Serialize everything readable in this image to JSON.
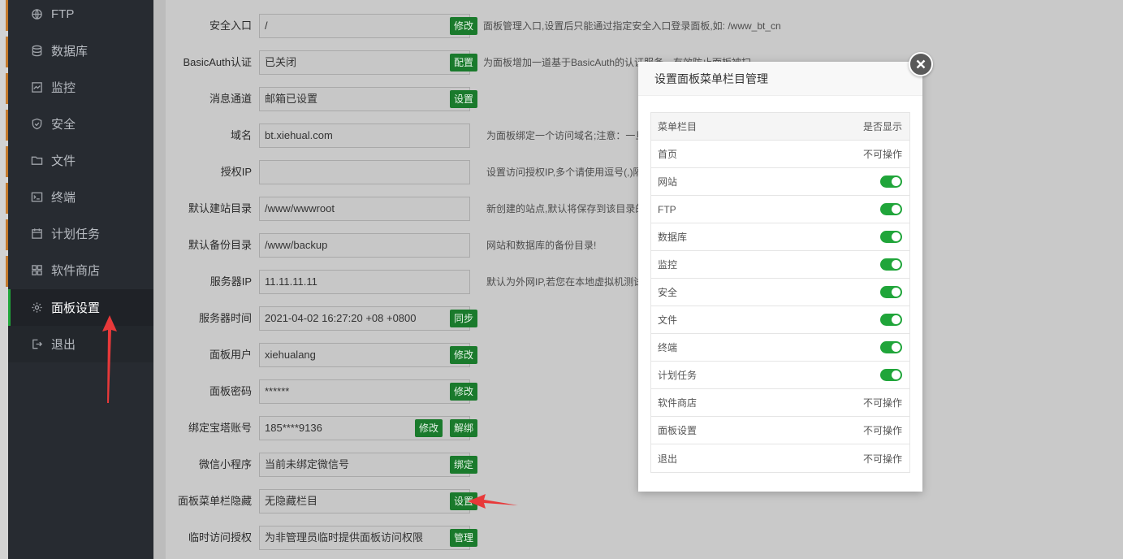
{
  "sidebar": {
    "items": [
      {
        "label": "FTP",
        "icon": "ftp-icon"
      },
      {
        "label": "数据库",
        "icon": "database-icon"
      },
      {
        "label": "监控",
        "icon": "monitor-icon"
      },
      {
        "label": "安全",
        "icon": "shield-icon"
      },
      {
        "label": "文件",
        "icon": "folder-icon"
      },
      {
        "label": "终端",
        "icon": "terminal-icon"
      },
      {
        "label": "计划任务",
        "icon": "calendar-icon"
      },
      {
        "label": "软件商店",
        "icon": "apps-icon"
      },
      {
        "label": "面板设置",
        "icon": "gear-icon"
      },
      {
        "label": "退出",
        "icon": "logout-icon"
      }
    ],
    "active": "面板设置"
  },
  "settings": {
    "rows": [
      {
        "label": "安全入口",
        "value": "/",
        "buttons": [
          "修改"
        ],
        "hint": "面板管理入口,设置后只能通过指定安全入口登录面板,如: /www_bt_cn"
      },
      {
        "label": "BasicAuth认证",
        "value": "已关闭",
        "buttons": [
          "配置"
        ],
        "hint": "为面板增加一道基于BasicAuth的认证服务，有效防止面板被扫"
      },
      {
        "label": "消息通道",
        "value": "邮箱已设置",
        "buttons": [
          "设置"
        ],
        "hint": ""
      },
      {
        "label": "域名",
        "value": "bt.xiehual.com",
        "buttons": [],
        "hint": "为面板绑定一个访问域名;注意：一旦"
      },
      {
        "label": "授权IP",
        "value": "",
        "buttons": [],
        "hint": "设置访问授权IP,多个请使用逗号(,)隔"
      },
      {
        "label": "默认建站目录",
        "value": "/www/wwwroot",
        "buttons": [],
        "hint": "新创建的站点,默认将保存到该目录的"
      },
      {
        "label": "默认备份目录",
        "value": "/www/backup",
        "buttons": [],
        "hint": "网站和数据库的备份目录!"
      },
      {
        "label": "服务器IP",
        "value": "11.11.11.11",
        "buttons": [],
        "hint": "默认为外网IP,若您在本地虚拟机测试"
      },
      {
        "label": "服务器时间",
        "value": "2021-04-02 16:27:20 +08 +0800",
        "buttons": [
          "同步"
        ],
        "hint": ""
      },
      {
        "label": "面板用户",
        "value": "xiehualang",
        "buttons": [
          "修改"
        ],
        "hint": ""
      },
      {
        "label": "面板密码",
        "value": "******",
        "buttons": [
          "修改"
        ],
        "hint": ""
      },
      {
        "label": "绑定宝塔账号",
        "value": "185****9136",
        "buttons": [
          "修改",
          "解绑"
        ],
        "hint": ""
      },
      {
        "label": "微信小程序",
        "value": "当前未绑定微信号",
        "buttons": [
          "绑定"
        ],
        "hint": ""
      },
      {
        "label": "面板菜单栏隐藏",
        "value": "无隐藏栏目",
        "buttons": [
          "设置"
        ],
        "hint": ""
      },
      {
        "label": "临时访问授权",
        "value": "为非管理员临时提供面板访问权限",
        "buttons": [
          "管理"
        ],
        "hint": ""
      }
    ]
  },
  "modal": {
    "title": "设置面板菜单栏目管理",
    "col_name": "菜单栏目",
    "col_show": "是否显示",
    "rows": [
      {
        "name": "首页",
        "status": "不可操作",
        "toggle": false
      },
      {
        "name": "网站",
        "status": "",
        "toggle": true
      },
      {
        "name": "FTP",
        "status": "",
        "toggle": true
      },
      {
        "name": "数据库",
        "status": "",
        "toggle": true
      },
      {
        "name": "监控",
        "status": "",
        "toggle": true
      },
      {
        "name": "安全",
        "status": "",
        "toggle": true
      },
      {
        "name": "文件",
        "status": "",
        "toggle": true
      },
      {
        "name": "终端",
        "status": "",
        "toggle": true
      },
      {
        "name": "计划任务",
        "status": "",
        "toggle": true
      },
      {
        "name": "软件商店",
        "status": "不可操作",
        "toggle": false
      },
      {
        "name": "面板设置",
        "status": "不可操作",
        "toggle": false
      },
      {
        "name": "退出",
        "status": "不可操作",
        "toggle": false
      }
    ]
  },
  "colors": {
    "accent": "#20a53a",
    "sidebar": "#272b31",
    "arrow": "#e8393a"
  }
}
